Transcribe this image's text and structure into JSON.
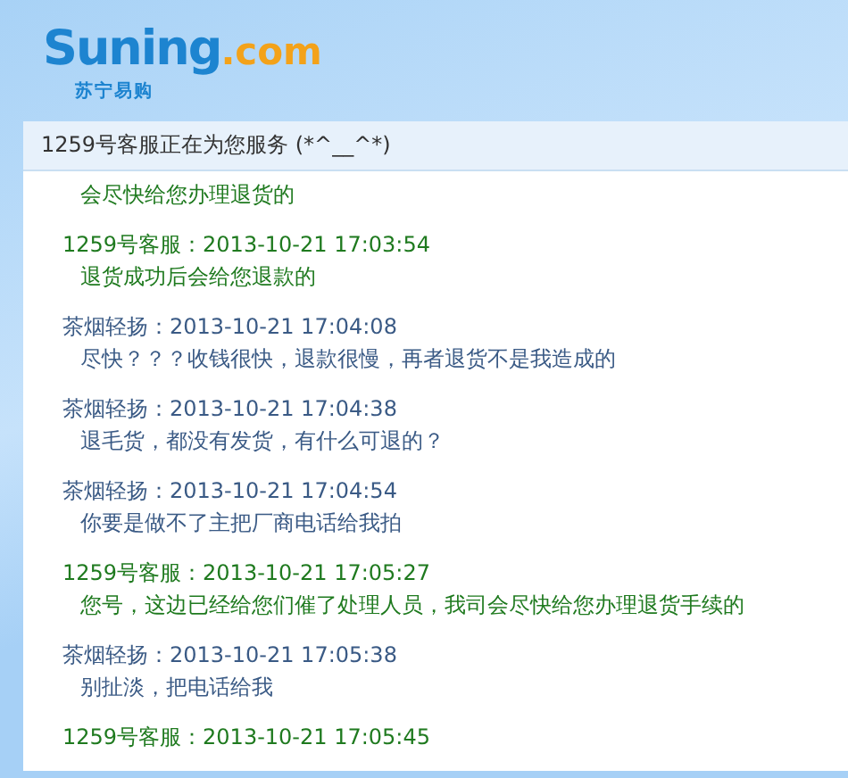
{
  "logo": {
    "brand": "Suning",
    "suffix": ".com",
    "subtitle": "苏宁易购"
  },
  "chat": {
    "title": "1259号客服正在为您服务 (*^__^*)",
    "messages": [
      {
        "kind": "agent",
        "body": "会尽快给您办理退货的"
      },
      {
        "kind": "agent",
        "header": "1259号客服：2013-10-21 17:03:54",
        "body": "退货成功后会给您退款的"
      },
      {
        "kind": "customer",
        "header": "茶烟轻扬：2013-10-21 17:04:08",
        "body": "尽快？？？收钱很快，退款很慢，再者退货不是我造成的"
      },
      {
        "kind": "customer",
        "header": "茶烟轻扬：2013-10-21 17:04:38",
        "body": "退毛货，都没有发货，有什么可退的？"
      },
      {
        "kind": "customer",
        "header": "茶烟轻扬：2013-10-21 17:04:54",
        "body": "你要是做不了主把厂商电话给我拍"
      },
      {
        "kind": "agent",
        "header": "1259号客服：2013-10-21 17:05:27",
        "body": "您号，这边已经给您们催了处理人员，我司会尽快给您办理退货手续的"
      },
      {
        "kind": "customer",
        "header": "茶烟轻扬：2013-10-21 17:05:38",
        "body": "别扯淡，把电话给我"
      },
      {
        "kind": "agent",
        "header": "1259号客服：2013-10-21 17:05:45"
      }
    ]
  }
}
